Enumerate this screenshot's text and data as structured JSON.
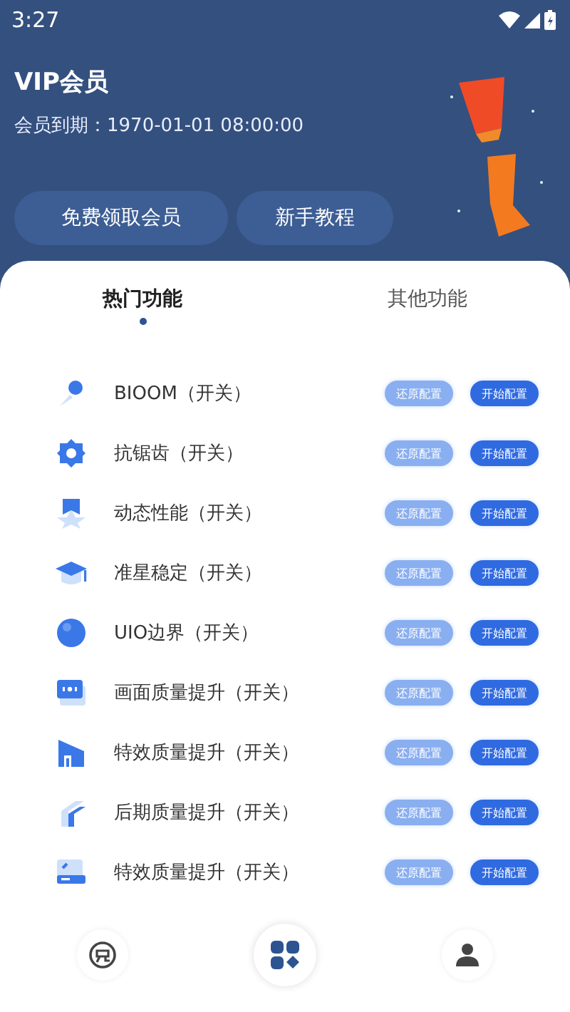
{
  "status_bar": {
    "time": "3:27"
  },
  "header": {
    "title": "VIP会员",
    "expiry": "会员到期：1970-01-01 08:00:00",
    "buttons": [
      "免费领取会员",
      "新手教程"
    ]
  },
  "tabs": [
    {
      "label": "热门功能",
      "selected": true
    },
    {
      "label": "其他功能",
      "selected": false
    }
  ],
  "features": [
    {
      "name": "BIOOM（开关）",
      "reset": "还原配置",
      "start": "开始配置"
    },
    {
      "name": "抗锯齿（开关）",
      "reset": "还原配置",
      "start": "开始配置"
    },
    {
      "name": "动态性能（开关）",
      "reset": "还原配置",
      "start": "开始配置"
    },
    {
      "name": "准星稳定（开关）",
      "reset": "还原配置",
      "start": "开始配置"
    },
    {
      "name": "UIO边界（开关）",
      "reset": "还原配置",
      "start": "开始配置"
    },
    {
      "name": "画面质量提升（开关）",
      "reset": "还原配置",
      "start": "开始配置"
    },
    {
      "name": "特效质量提升（开关）",
      "reset": "还原配置",
      "start": "开始配置"
    },
    {
      "name": "后期质量提升（开关）",
      "reset": "还原配置",
      "start": "开始配置"
    },
    {
      "name": "特效质量提升（开关）",
      "reset": "还原配置",
      "start": "开始配置"
    }
  ],
  "bottom_nav": [
    {
      "kind": "free",
      "selected": false
    },
    {
      "kind": "apps",
      "selected": true
    },
    {
      "kind": "user",
      "selected": false
    }
  ]
}
